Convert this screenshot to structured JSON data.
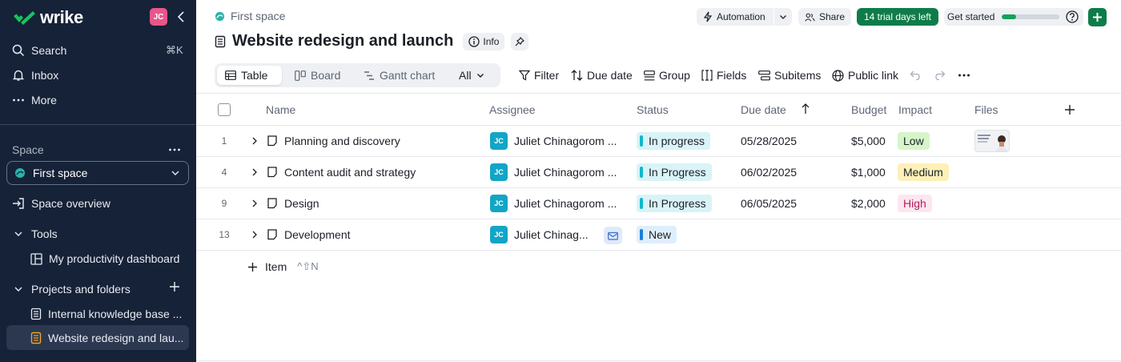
{
  "app": {
    "logo": "wrike",
    "user_initials": "JC"
  },
  "sidebar": {
    "nav": [
      {
        "label": "Search",
        "icon": "search-icon",
        "shortcut": "⌘K"
      },
      {
        "label": "Inbox",
        "icon": "bell-icon"
      },
      {
        "label": "More",
        "icon": "more-icon"
      }
    ],
    "space_section": "Space",
    "space_selected": "First space",
    "space_overview": "Space overview",
    "tools": {
      "label": "Tools",
      "items": [
        "My productivity dashboard"
      ]
    },
    "projects": {
      "label": "Projects and folders",
      "items": [
        "Internal knowledge base ...",
        "Website redesign and lau..."
      ],
      "active_index": 1
    }
  },
  "header": {
    "breadcrumb": "First space",
    "title": "Website redesign and launch",
    "info_label": "Info",
    "automation_label": "Automation",
    "share_label": "Share",
    "trial_label": "14 trial days left",
    "get_started_label": "Get started",
    "get_started_progress": 0.25
  },
  "views": {
    "tabs": [
      "Table",
      "Board",
      "Gantt chart"
    ],
    "active": "Table",
    "all_label": "All"
  },
  "toolbar": {
    "filter": "Filter",
    "due_date": "Due date",
    "group": "Group",
    "fields": "Fields",
    "subitems": "Subitems",
    "public_link": "Public link"
  },
  "table": {
    "columns": [
      "Name",
      "Assignee",
      "Status",
      "Due date",
      "Budget",
      "Impact",
      "Files"
    ],
    "rows": [
      {
        "num": "1",
        "name": "Planning and discovery",
        "assignee": "Juliet Chinagorom ...",
        "initials": "JC",
        "status": "In progress",
        "status_color": "#12b8cf",
        "due": "05/28/2025",
        "budget": "$5,000",
        "impact": "Low",
        "impact_bg": "#d6f5c9",
        "impact_fg": "#1b1f27"
      },
      {
        "num": "4",
        "name": "Content audit and strategy",
        "assignee": "Juliet Chinagorom ...",
        "initials": "JC",
        "status": "In Progress",
        "status_color": "#12b8cf",
        "due": "06/02/2025",
        "budget": "$1,000",
        "impact": "Medium",
        "impact_bg": "#fdf0b8",
        "impact_fg": "#1b1f27"
      },
      {
        "num": "9",
        "name": "Design",
        "assignee": "Juliet Chinagorom ...",
        "initials": "JC",
        "status": "In Progress",
        "status_color": "#12b8cf",
        "due": "06/05/2025",
        "budget": "$2,000",
        "impact": "High",
        "impact_bg": "#fde6f0",
        "impact_fg": "#b0205e"
      },
      {
        "num": "13",
        "name": "Development",
        "assignee": "Juliet Chinag...",
        "initials": "JC",
        "status": "New",
        "status_color": "#1e7fd8",
        "due": "",
        "budget": "",
        "impact": "",
        "impact_bg": "",
        "impact_fg": ""
      }
    ],
    "add_item_label": "Item",
    "add_item_shortcut": "^⇧N"
  }
}
